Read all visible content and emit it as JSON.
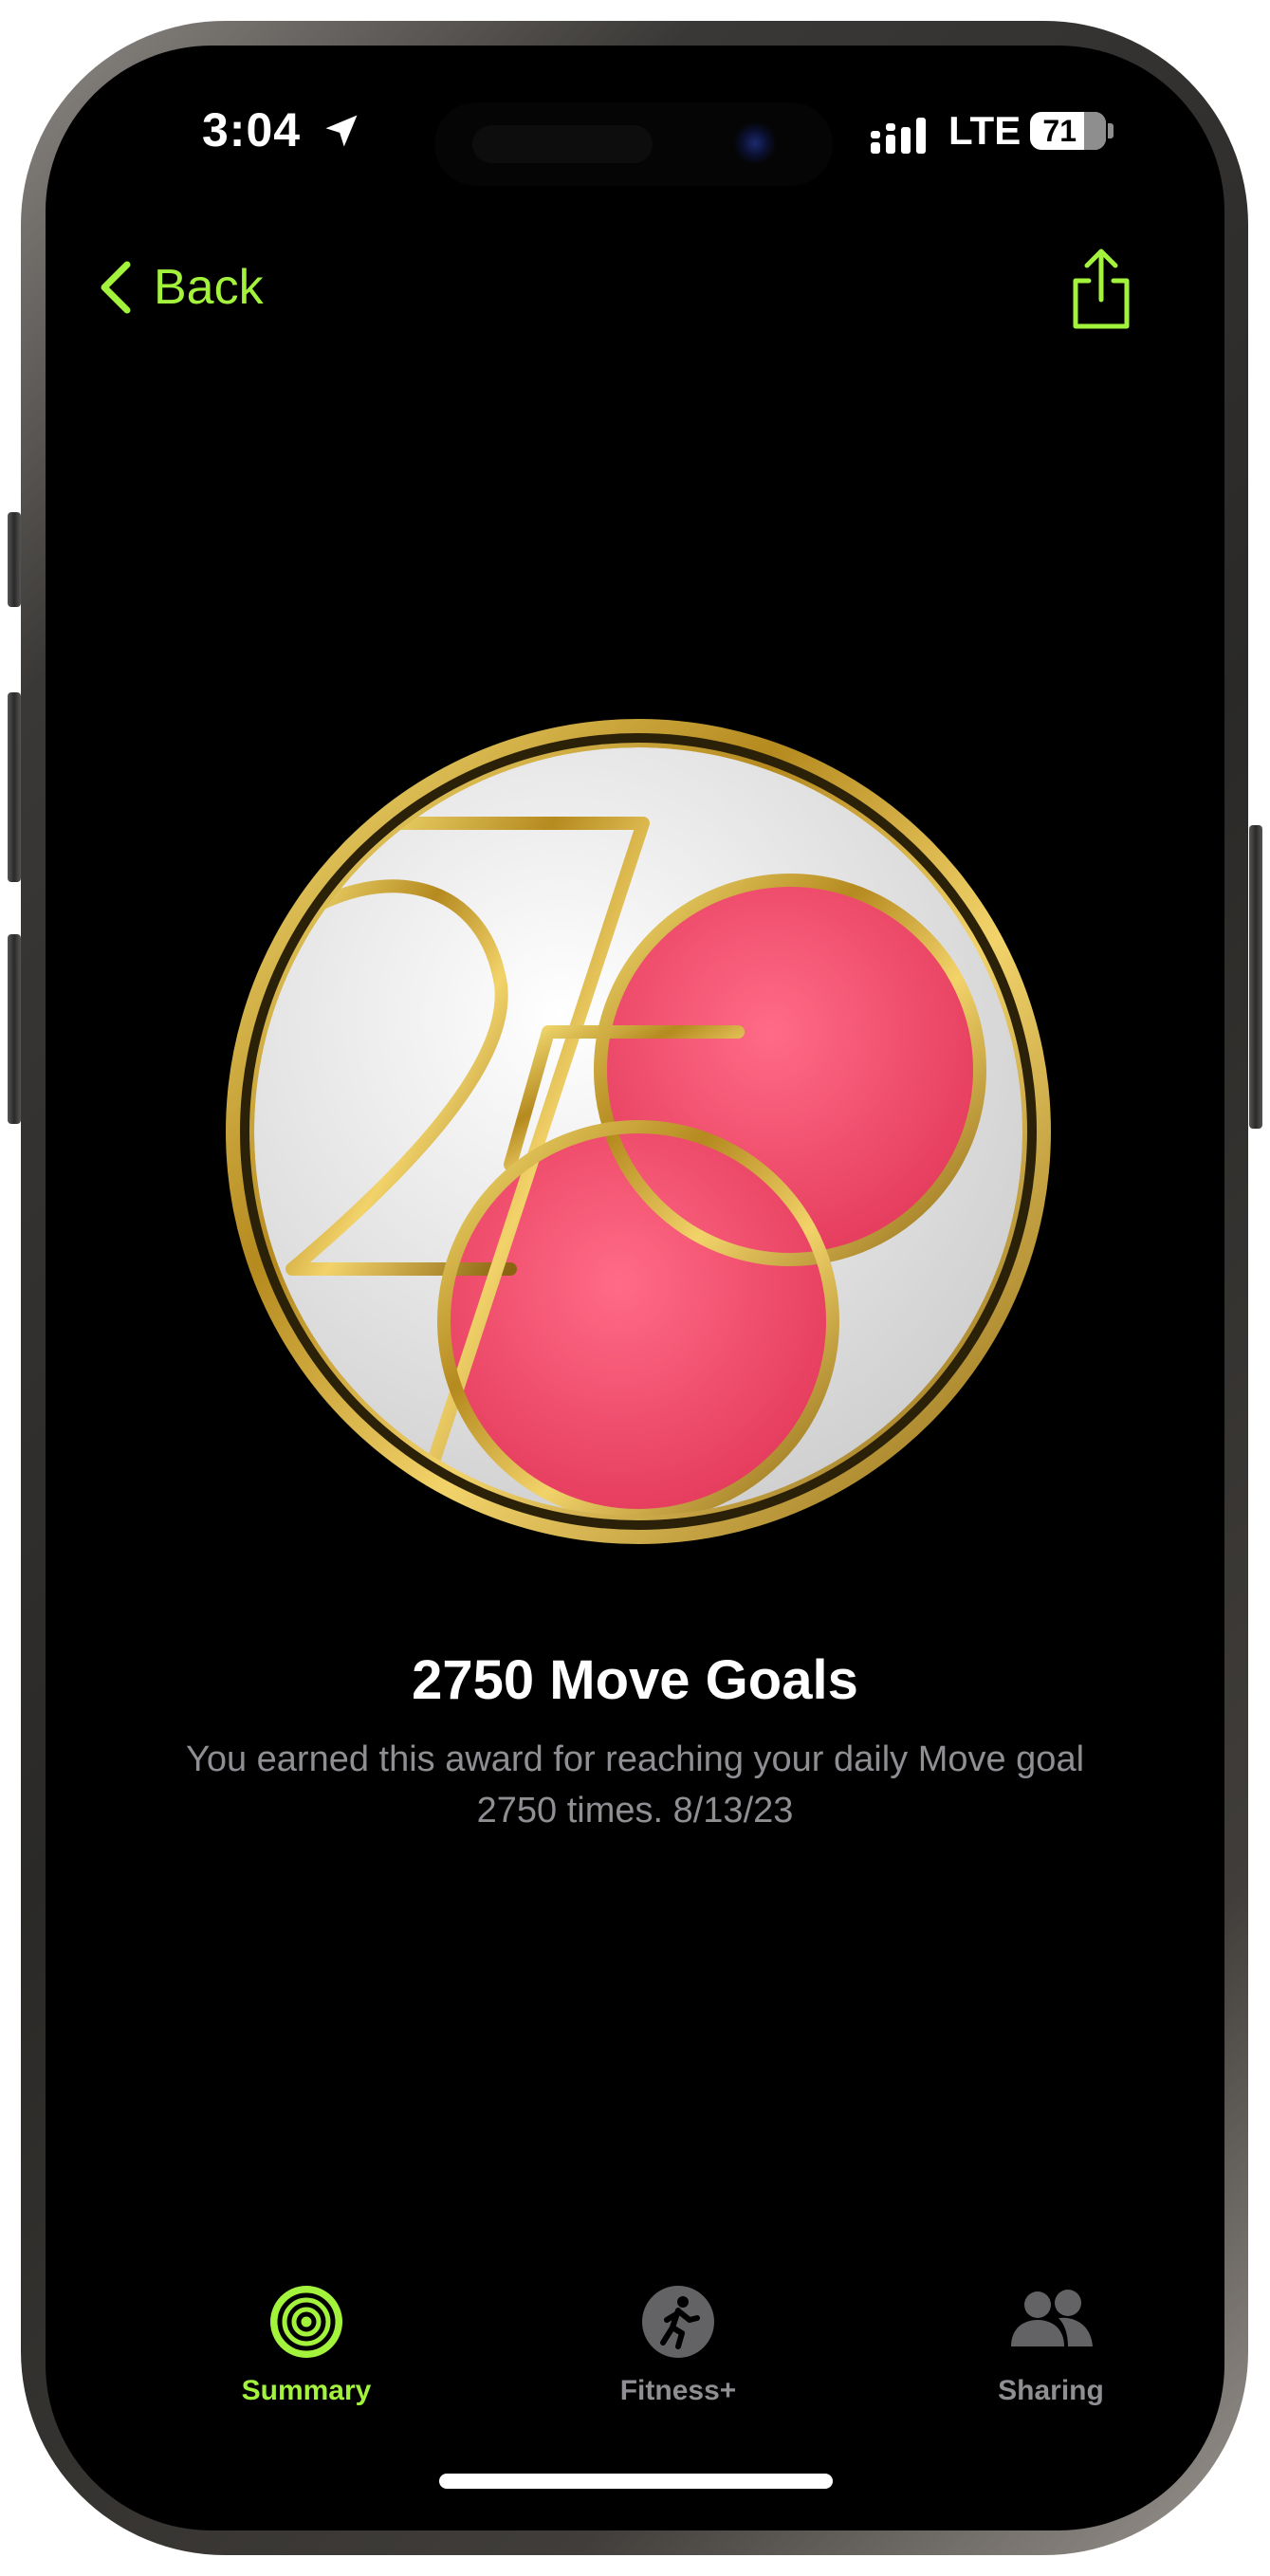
{
  "status_bar": {
    "time": "3:04",
    "location_icon": "location-arrow-icon",
    "signal_icon": "cellular-signal-icon",
    "network": "LTE",
    "battery": "71",
    "battery_level": 0.71
  },
  "nav": {
    "back_label": "Back",
    "back_icon": "chevron-left-icon",
    "share_icon": "share-icon",
    "accent_color": "#a3f33d"
  },
  "award": {
    "badge_icon": "2750-move-goals-medal-icon",
    "title": "2750 Move Goals",
    "description": "You earned this award for reaching your daily Move goal 2750 times. 8/13/23"
  },
  "tab_bar": {
    "tabs": [
      {
        "label": "Summary",
        "icon": "activity-rings-icon",
        "selected": true
      },
      {
        "label": "Fitness+",
        "icon": "running-figure-icon",
        "selected": false
      },
      {
        "label": "Sharing",
        "icon": "people-icon",
        "selected": false
      }
    ],
    "selected_color": "#a3f33d",
    "unselected_color": "#8e8e93"
  }
}
